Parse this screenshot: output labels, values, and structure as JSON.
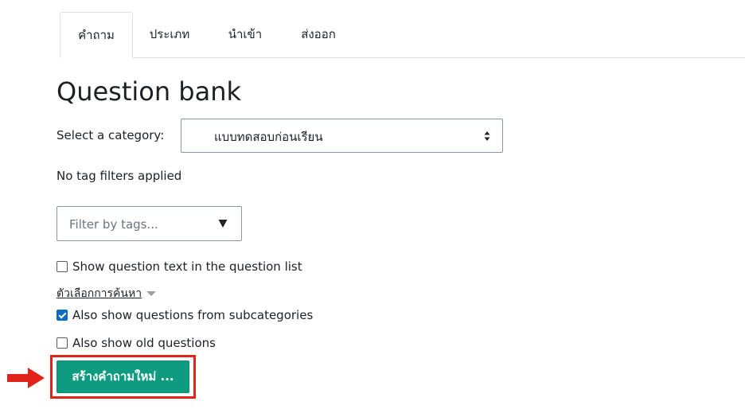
{
  "tabs": [
    {
      "label": "คำถาม",
      "active": true
    },
    {
      "label": "ประเภท",
      "active": false
    },
    {
      "label": "นำเข้า",
      "active": false
    },
    {
      "label": "ส่งออก",
      "active": false
    }
  ],
  "page_title": "Question bank",
  "category": {
    "label": "Select a category:",
    "selected": "แบบทดสอบก่อนเรียน",
    "icon": "sort-icon"
  },
  "tag_status": "No tag filters applied",
  "tag_filter": {
    "placeholder": "Filter by tags...",
    "icon": "dropdown-triangle-icon"
  },
  "options": {
    "show_question_text": {
      "label": "Show question text in the question list",
      "checked": false
    },
    "search_options_label": "ตัวเลือกการค้นหา",
    "subcategories": {
      "label": "Also show questions from subcategories",
      "checked": true
    },
    "old_questions": {
      "label": "Also show old questions",
      "checked": false
    }
  },
  "create_button": {
    "label": "สร้างคำถามใหม่ ..."
  },
  "colors": {
    "button": "#0f9b80",
    "highlight": "#e2231a",
    "checkbox_checked": "#0f6cbf"
  }
}
